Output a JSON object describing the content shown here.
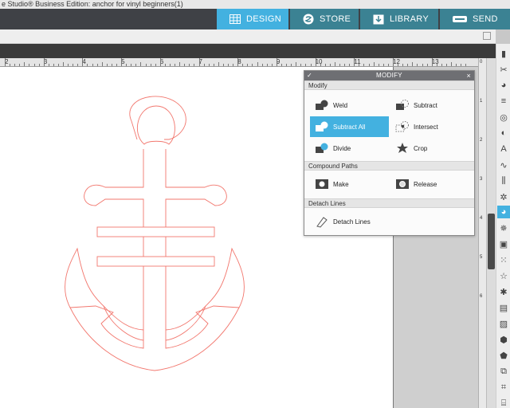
{
  "window": {
    "title": "e Studio® Business Edition: anchor for vinyl beginners(1)"
  },
  "nav": {
    "design_label": "DESIGN",
    "store_label": "STORE",
    "library_label": "LIBRARY",
    "send_label": "SEND"
  },
  "ruler": {
    "labels": [
      "2",
      "3",
      "4",
      "5",
      "6",
      "7",
      "8",
      "9",
      "10",
      "11",
      "12",
      "13"
    ]
  },
  "vruler": {
    "labels": [
      "0",
      "1",
      "2",
      "3",
      "4",
      "5",
      "6"
    ]
  },
  "panel": {
    "title": "MODIFY",
    "modify_section": "Modify",
    "weld_label": "Weld",
    "subtract_label": "Subtract",
    "subtract_all_label": "Subtract All",
    "intersect_label": "Intersect",
    "divide_label": "Divide",
    "crop_label": "Crop",
    "compound_section": "Compound Paths",
    "make_label": "Make",
    "release_label": "Release",
    "detach_section": "Detach Lines",
    "detach_label": "Detach Lines"
  },
  "colors": {
    "accent": "#43b1e0",
    "nav_bg": "#3f4146",
    "tab_bg": "#3b8293",
    "cut_line": "#f2776e"
  }
}
